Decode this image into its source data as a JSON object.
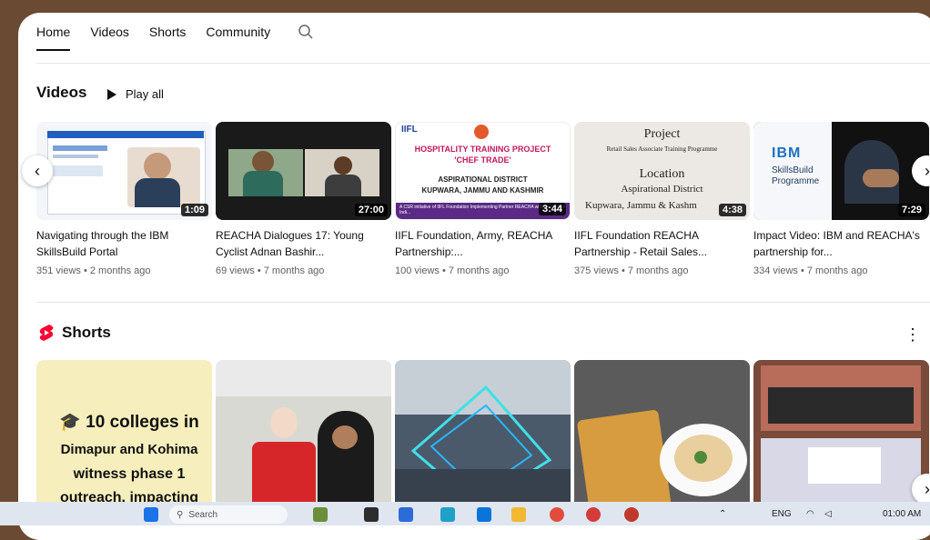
{
  "tabs": {
    "home": "Home",
    "videos": "Videos",
    "shorts": "Shorts",
    "community": "Community"
  },
  "videos_section": {
    "title": "Videos",
    "play_all": "Play all"
  },
  "videos": [
    {
      "title": "Navigating through the IBM SkillsBuild Portal",
      "meta": "351 views • 2 months ago",
      "duration": "1:09"
    },
    {
      "title": "REACHA Dialogues 17: Young Cyclist Adnan Bashir...",
      "meta": "69 views • 7 months ago",
      "duration": "27:00"
    },
    {
      "title": "IIFL Foundation, Army, REACHA Partnership:...",
      "meta": "100 views • 7 months ago",
      "duration": "3:44"
    },
    {
      "title": "IIFL Foundation REACHA Partnership - Retail Sales...",
      "meta": "375 views • 7 months ago",
      "duration": "4:38"
    },
    {
      "title": "Impact Video: IBM and REACHA's partnership for...",
      "meta": "334 views • 7 months ago",
      "duration": "7:29"
    }
  ],
  "thumb_text": {
    "iifl_logo": "IIFL",
    "hosp_title": "HOSPITALITY TRAINING PROJECT",
    "hosp_sub": "'CHEF TRADE'",
    "hosp_district": "ASPIRATIONAL DISTRICT",
    "hosp_place": "KUPWARA, JAMMU AND KASHMIR",
    "hosp_footer": "A CSR initiative of IIFL Foundation Implementing Partner REACHA with Support of Indi...",
    "proj_title": "Project",
    "proj_sub": "Retail Sales Associate Training Programme",
    "proj_loc": "Location",
    "proj_district": "Aspirational District",
    "proj_place": "Kupwara, Jammu & Kashm",
    "ibm_logo": "IBM",
    "ibm_sub1": "SkillsBuild",
    "ibm_sub2": "Programme"
  },
  "shorts_section": {
    "title": "Shorts"
  },
  "shorts_first": {
    "line1": "10 colleges in",
    "line2": "Dimapur and Kohima",
    "line3": "witness phase 1",
    "line4": "outreach, impacting"
  },
  "taskbar": {
    "search": "Search",
    "lang": "ENG",
    "time": "01:00 AM"
  },
  "colors": {
    "accent": "#ff0033",
    "page_bg": "#6b4a33",
    "taskbar": "#dfe6f0"
  }
}
